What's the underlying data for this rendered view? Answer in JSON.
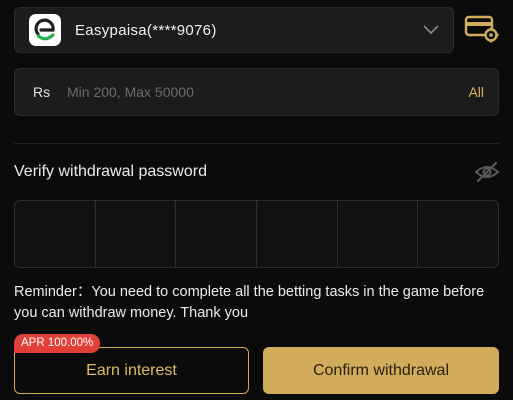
{
  "account": {
    "name": "Easypaisa(****9076)",
    "logo_icon": "easypaisa-logo",
    "dropdown_icon": "chevron-down-icon",
    "settings_icon": "card-settings-icon"
  },
  "amount": {
    "currency": "Rs",
    "placeholder": "Min 200, Max 50000",
    "all_label": "All"
  },
  "password": {
    "label": "Verify withdrawal password",
    "toggle_icon": "eye-off-icon",
    "digits": 6
  },
  "reminder": "Reminder：You need to complete all the betting tasks in the game before you can withdraw money. Thank you",
  "actions": {
    "earn_label": "Earn interest",
    "apr_badge": "APR 100.00%",
    "confirm_label": "Confirm withdrawal"
  },
  "colors": {
    "accent": "#d2ac5d",
    "badge": "#e04038",
    "background": "#0b0b0b",
    "field": "#1c1c1c"
  }
}
